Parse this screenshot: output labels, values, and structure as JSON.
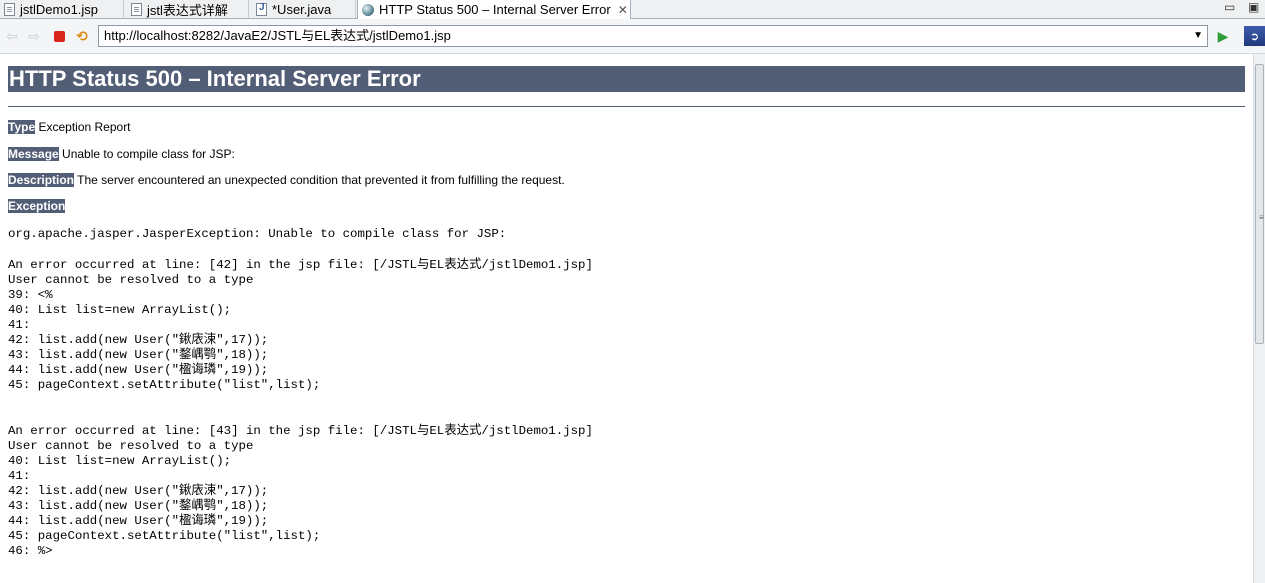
{
  "tabs": [
    {
      "label": "jstlDemo1.jsp",
      "icon": "jsp-file-icon"
    },
    {
      "label": "jstl表达式详解",
      "icon": "document-icon"
    },
    {
      "label": "*User.java",
      "icon": "java-file-icon"
    },
    {
      "label": "HTTP Status 500 – Internal Server Error",
      "icon": "globe-icon",
      "active": true
    }
  ],
  "address_bar": {
    "url": "http://localhost:8282/JavaE2/JSTL与EL表达式/jstlDemo1.jsp"
  },
  "page": {
    "title": "HTTP Status 500 – Internal Server Error",
    "type_label": "Type",
    "type_value": "Exception Report",
    "message_label": "Message",
    "message_value": "Unable to compile class for JSP:",
    "description_label": "Description",
    "description_value": "The server encountered an unexpected condition that prevented it from fulfilling the request.",
    "exception_label": "Exception",
    "exception_line": "org.apache.jasper.JasperException: Unable to compile class for JSP:",
    "error_block_1": "An error occurred at line: [42] in the jsp file: [/JSTL与EL表达式/jstlDemo1.jsp]\nUser cannot be resolved to a type\n39: <%\n40: List list=new ArrayList();\n41:\n42: list.add(new User(\"鍬庡涑\",17));\n43: list.add(new User(\"鍪嵎鹗\",18));\n44: list.add(new User(\"楹诲璘\",19));\n45: pageContext.setAttribute(\"list\",list);",
    "error_block_2": "An error occurred at line: [43] in the jsp file: [/JSTL与EL表达式/jstlDemo1.jsp]\nUser cannot be resolved to a type\n40: List list=new ArrayList();\n41:\n42: list.add(new User(\"鍬庡涑\",17));\n43: list.add(new User(\"鍪嵎鹗\",18));\n44: list.add(new User(\"楹诲璘\",19));\n45: pageContext.setAttribute(\"list\",list);\n46: %>"
  },
  "colors": {
    "header_bg": "#525d76",
    "header_text": "#ffffff"
  }
}
